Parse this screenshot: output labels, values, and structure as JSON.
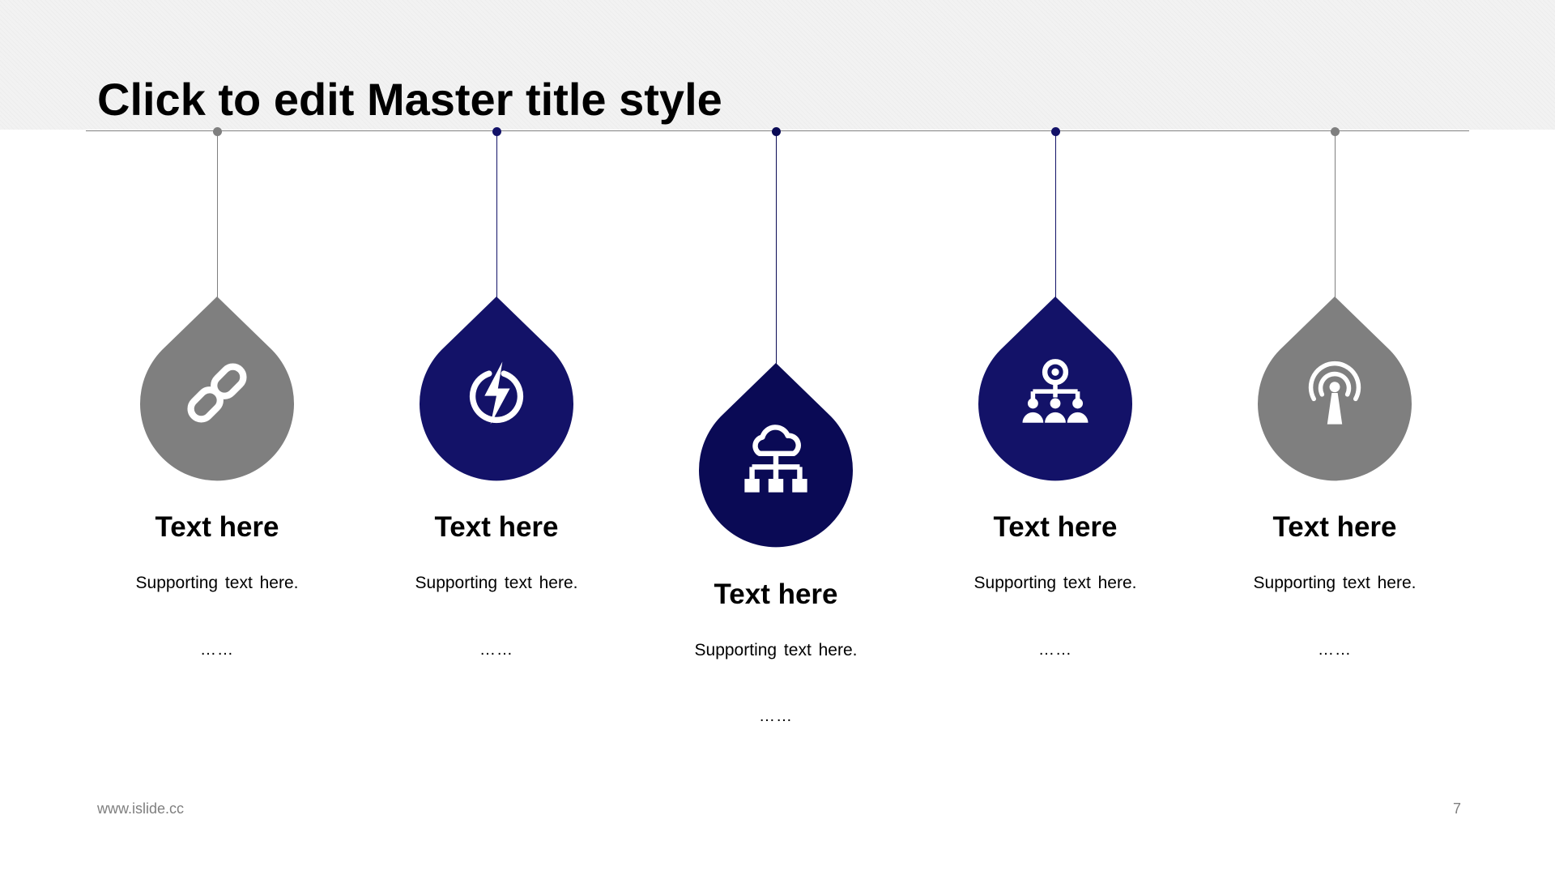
{
  "slide": {
    "title": "Click to edit Master title style",
    "footer_url": "www.islide.cc",
    "page_number": "7"
  },
  "colors": {
    "gray": "#7f7f7f",
    "navy": "#131268",
    "navy_dark": "#0a0a55",
    "rule": "#7f7f7f"
  },
  "items": [
    {
      "icon": "link-icon",
      "color": "#7f7f7f",
      "heading": "Text here",
      "description": "Supporting text here.",
      "more": "……"
    },
    {
      "icon": "lightning-icon",
      "color": "#131268",
      "heading": "Text here",
      "description": "Supporting text here.",
      "more": "……"
    },
    {
      "icon": "cloud-network-icon",
      "color": "#0a0a55",
      "heading": "Text here",
      "description": "Supporting text here.",
      "more": "……"
    },
    {
      "icon": "team-hierarchy-icon",
      "color": "#131268",
      "heading": "Text here",
      "description": "Supporting text here.",
      "more": "……"
    },
    {
      "icon": "broadcast-antenna-icon",
      "color": "#7f7f7f",
      "heading": "Text here",
      "description": "Supporting text here.",
      "more": "……"
    }
  ]
}
